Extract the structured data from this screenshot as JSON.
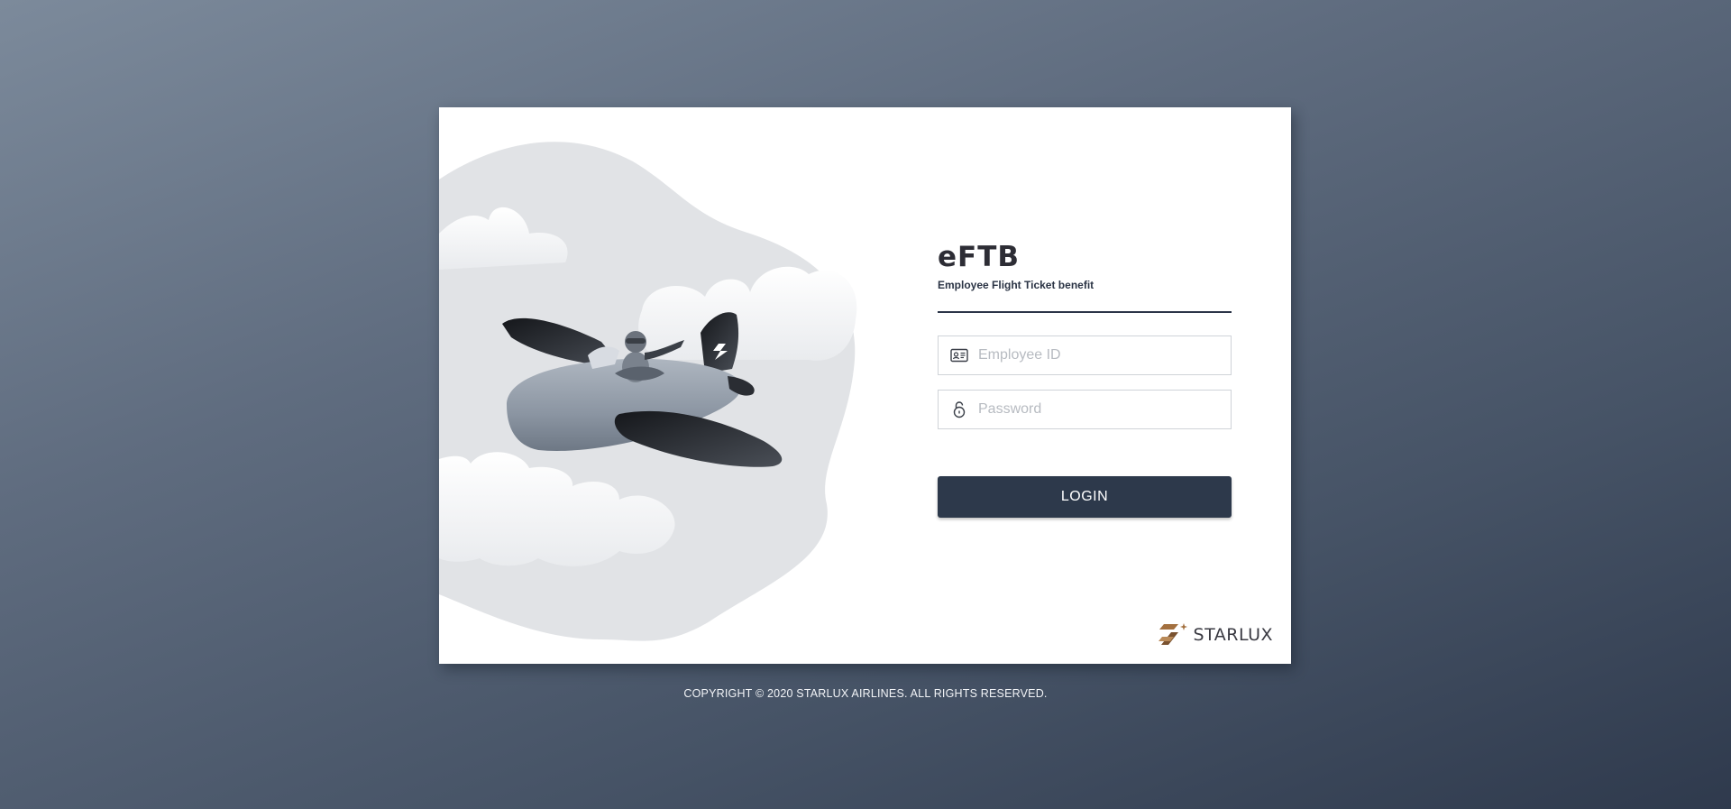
{
  "app": {
    "logo_text": "eFTB",
    "subtitle": "Employee Flight Ticket benefit"
  },
  "form": {
    "employee_id": {
      "icon": "id-card-icon",
      "value": "",
      "placeholder": "Employee ID"
    },
    "password": {
      "icon": "lock-icon",
      "value": "",
      "placeholder": "Password"
    },
    "login_label": "LOGIN"
  },
  "brand": {
    "name": "STARLUX",
    "icon": "starlux-logo-icon"
  },
  "illustration": {
    "icon": "airplane-illustration"
  },
  "footer": {
    "copyright": "COPYRIGHT © 2020 STARLUX AIRLINES. ALL RIGHTS RESERVED."
  },
  "colors": {
    "primary": "#2d394b",
    "brand_gold": "#9b6a3c",
    "card_bg": "#ffffff",
    "cloud_bg": "#e1e3e6"
  }
}
